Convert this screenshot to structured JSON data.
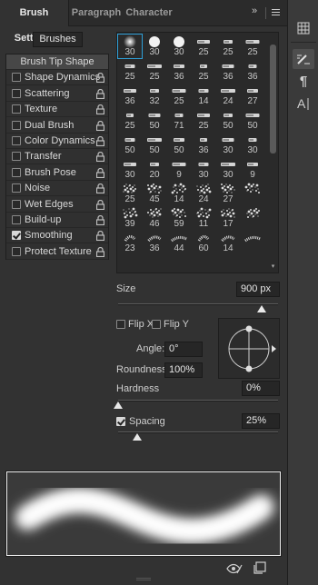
{
  "tabs": [
    {
      "label": "Brush Settings",
      "active": true
    },
    {
      "label": "Paragraph",
      "active": false
    },
    {
      "label": "Character",
      "active": false
    }
  ],
  "tab_controls": {
    "overflow": "»",
    "menu": "menu-icon"
  },
  "brushes_button": "Brushes",
  "options": [
    {
      "label": "Brush Tip Shape",
      "has_checkbox": false,
      "checked": false,
      "lock": false,
      "selected": true
    },
    {
      "label": "Shape Dynamics",
      "has_checkbox": true,
      "checked": false,
      "lock": true
    },
    {
      "label": "Scattering",
      "has_checkbox": true,
      "checked": false,
      "lock": true
    },
    {
      "label": "Texture",
      "has_checkbox": true,
      "checked": false,
      "lock": true
    },
    {
      "label": "Dual Brush",
      "has_checkbox": true,
      "checked": false,
      "lock": true
    },
    {
      "label": "Color Dynamics",
      "has_checkbox": true,
      "checked": false,
      "lock": true
    },
    {
      "label": "Transfer",
      "has_checkbox": true,
      "checked": false,
      "lock": true
    },
    {
      "label": "Brush Pose",
      "has_checkbox": true,
      "checked": false,
      "lock": true
    },
    {
      "label": "Noise",
      "has_checkbox": true,
      "checked": false,
      "lock": true
    },
    {
      "label": "Wet Edges",
      "has_checkbox": true,
      "checked": false,
      "lock": true
    },
    {
      "label": "Build-up",
      "has_checkbox": true,
      "checked": false,
      "lock": true
    },
    {
      "label": "Smoothing",
      "has_checkbox": true,
      "checked": true,
      "lock": true
    },
    {
      "label": "Protect Texture",
      "has_checkbox": true,
      "checked": false,
      "lock": true
    }
  ],
  "brush_presets": [
    {
      "size": "30",
      "kind": "soft"
    },
    {
      "size": "30",
      "kind": "hard"
    },
    {
      "size": "30",
      "kind": "hard"
    },
    {
      "size": "25",
      "kind": "chalk"
    },
    {
      "size": "25",
      "kind": "chalk"
    },
    {
      "size": "25",
      "kind": "chalk"
    },
    {
      "size": "25",
      "kind": "chalk"
    },
    {
      "size": "25",
      "kind": "chalk"
    },
    {
      "size": "36",
      "kind": "chalk"
    },
    {
      "size": "25",
      "kind": "chalk"
    },
    {
      "size": "36",
      "kind": "chalk"
    },
    {
      "size": "36",
      "kind": "chalk"
    },
    {
      "size": "36",
      "kind": "chalk"
    },
    {
      "size": "32",
      "kind": "chalk"
    },
    {
      "size": "25",
      "kind": "chalk"
    },
    {
      "size": "14",
      "kind": "chalk"
    },
    {
      "size": "24",
      "kind": "chalk"
    },
    {
      "size": "27",
      "kind": "chalk"
    },
    {
      "size": "25",
      "kind": "chalk"
    },
    {
      "size": "50",
      "kind": "chalk"
    },
    {
      "size": "71",
      "kind": "chalk"
    },
    {
      "size": "25",
      "kind": "chalk"
    },
    {
      "size": "50",
      "kind": "chalk"
    },
    {
      "size": "50",
      "kind": "chalk"
    },
    {
      "size": "50",
      "kind": "chalk"
    },
    {
      "size": "50",
      "kind": "chalk"
    },
    {
      "size": "50",
      "kind": "chalk"
    },
    {
      "size": "36",
      "kind": "chalk"
    },
    {
      "size": "30",
      "kind": "chalk"
    },
    {
      "size": "30",
      "kind": "chalk"
    },
    {
      "size": "30",
      "kind": "chalk"
    },
    {
      "size": "20",
      "kind": "chalk"
    },
    {
      "size": "9",
      "kind": "chalk"
    },
    {
      "size": "30",
      "kind": "chalk"
    },
    {
      "size": "30",
      "kind": "chalk"
    },
    {
      "size": "9",
      "kind": "chalk"
    },
    {
      "size": "25",
      "kind": "spatter"
    },
    {
      "size": "45",
      "kind": "spatter"
    },
    {
      "size": "14",
      "kind": "spatter"
    },
    {
      "size": "24",
      "kind": "spatter"
    },
    {
      "size": "27",
      "kind": "spatter"
    },
    {
      "size": "",
      "kind": "spatter"
    },
    {
      "size": "39",
      "kind": "spatter"
    },
    {
      "size": "46",
      "kind": "spatter"
    },
    {
      "size": "59",
      "kind": "spatter"
    },
    {
      "size": "11",
      "kind": "spatter"
    },
    {
      "size": "17",
      "kind": "spatter"
    },
    {
      "size": "",
      "kind": "spatter"
    },
    {
      "size": "23",
      "kind": "texture"
    },
    {
      "size": "36",
      "kind": "texture"
    },
    {
      "size": "44",
      "kind": "texture"
    },
    {
      "size": "60",
      "kind": "texture"
    },
    {
      "size": "14",
      "kind": "texture"
    },
    {
      "size": "",
      "kind": "texture"
    }
  ],
  "size": {
    "label": "Size",
    "value": "900 px",
    "percent": 0.9
  },
  "flip_x": {
    "label": "Flip X",
    "checked": false
  },
  "flip_y": {
    "label": "Flip Y",
    "checked": false
  },
  "angle": {
    "label": "Angle:",
    "value": "0°"
  },
  "roundness": {
    "label": "Roundness:",
    "value": "100%"
  },
  "hardness": {
    "label": "Hardness",
    "value": "0%",
    "percent": 0.0
  },
  "spacing": {
    "label": "Spacing",
    "value": "25%",
    "checked": true,
    "percent": 0.12
  },
  "bottom_icons": [
    "eye-brush-icon",
    "new-brush-icon"
  ],
  "right_strip_icons": [
    "table-icon",
    "brush-settings-icon",
    "paragraph-icon",
    "character-icon"
  ],
  "colors": {
    "panel_bg": "#323232",
    "accent_selection": "#2fa0d8",
    "preview_fg": "#ffffff"
  }
}
